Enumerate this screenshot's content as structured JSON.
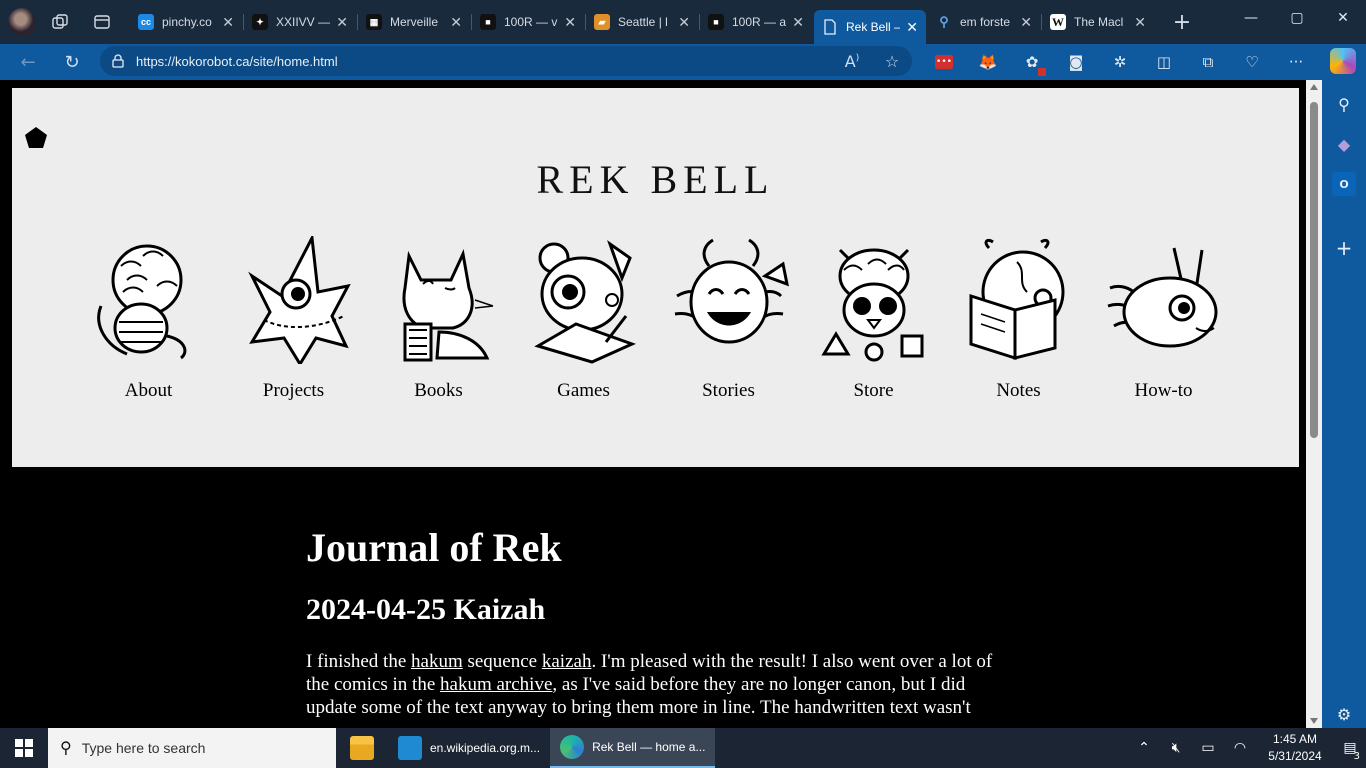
{
  "browser": {
    "tabs": [
      {
        "label": "pinchy.co",
        "favicon_text": "cc",
        "favicon_color": "#1e88e5"
      },
      {
        "label": "XXIIVV —",
        "favicon_text": "✦",
        "favicon_color": "#111111"
      },
      {
        "label": "Merveille",
        "favicon_text": "▦",
        "favicon_color": "#111111"
      },
      {
        "label": "100R — v",
        "favicon_text": "■",
        "favicon_color": "#111111"
      },
      {
        "label": "Seattle | l",
        "favicon_text": "▰",
        "favicon_color": "#e0902a"
      },
      {
        "label": "100R — a",
        "favicon_text": "■",
        "favicon_color": "#111111"
      },
      {
        "label": "Rek Bell –",
        "favicon_text": "🗋",
        "favicon_color": "#0f5a9e"
      },
      {
        "label": "em forste",
        "favicon_text": "⚲",
        "favicon_color": "#1a2a3d"
      },
      {
        "label": "The Macl",
        "favicon_text": "W",
        "favicon_color": "#ffffff"
      }
    ],
    "url": "https://kokorobot.ca/site/home.html",
    "accent": "#0f5a9e"
  },
  "site": {
    "title": "REK BELL",
    "menu": [
      {
        "label": "About"
      },
      {
        "label": "Projects"
      },
      {
        "label": "Books"
      },
      {
        "label": "Games"
      },
      {
        "label": "Stories"
      },
      {
        "label": "Store"
      },
      {
        "label": "Notes"
      },
      {
        "label": "How-to"
      }
    ]
  },
  "content": {
    "heading": "Journal of Rek",
    "entry_title": "2024-04-25 Kaizah",
    "p1_a": "I finished the ",
    "link1": "hakum",
    "p1_b": " sequence ",
    "link2": "kaizah",
    "p1_c": ". I'm pleased with the result! I also went over a lot of the comics in the ",
    "link3": "hakum archive",
    "p1_d": ", as I've said before they are no longer canon, but I did update some of the text anyway to bring them more in line. The handwritten text wasn't"
  },
  "taskbar": {
    "search_placeholder": "Type here to search",
    "apps": [
      {
        "label": "en.wikipedia.org.m..."
      },
      {
        "label": "Rek Bell — home a..."
      }
    ],
    "time": "1:45 AM",
    "date": "5/31/2024",
    "notifications": "3"
  }
}
